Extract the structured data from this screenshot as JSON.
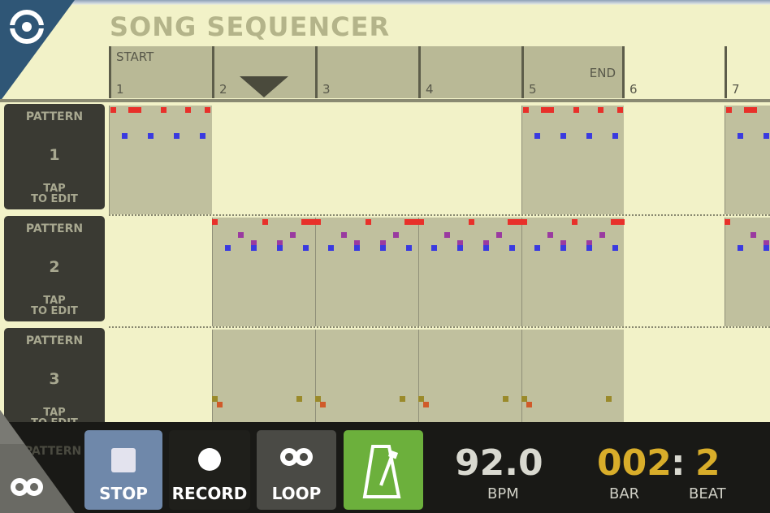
{
  "title": "SONG SEQUENCER",
  "timeline": {
    "start_label": "START",
    "end_label": "END",
    "bars": [
      "1",
      "2",
      "3",
      "4",
      "5",
      "6",
      "7"
    ],
    "playhead_bar": 2
  },
  "patterns": [
    {
      "label": "PATTERN",
      "number": "1",
      "hint_line1": "TAP",
      "hint_line2": "TO EDIT"
    },
    {
      "label": "PATTERN",
      "number": "2",
      "hint_line1": "TAP",
      "hint_line2": "TO EDIT"
    },
    {
      "label": "PATTERN",
      "number": "3",
      "hint_line1": "TAP",
      "hint_line2": "TO EDIT"
    }
  ],
  "peek_label": "PATTERN",
  "toolbar": {
    "stop_label": "STOP",
    "record_label": "RECORD",
    "loop_label": "LOOP",
    "metronome_icon": "metronome-icon"
  },
  "transport": {
    "bpm_value": "92.0",
    "bpm_label": "BPM",
    "bar_value": "002",
    "separator": ":",
    "beat_value": "2",
    "bar_label": "BAR",
    "beat_label": "BEAT"
  },
  "colors": {
    "background": "#f2f2c8",
    "active_cell": "#c0c09e",
    "note_red": "#e8302a",
    "note_blue": "#3a3ae0",
    "note_purple": "#9a3aa0",
    "note_olive": "#9a8a2a",
    "note_orange": "#d05a2a",
    "stop_button": "#6f88aa",
    "metronome_button": "#6cb03c",
    "counter_color": "#d8ad2a"
  }
}
